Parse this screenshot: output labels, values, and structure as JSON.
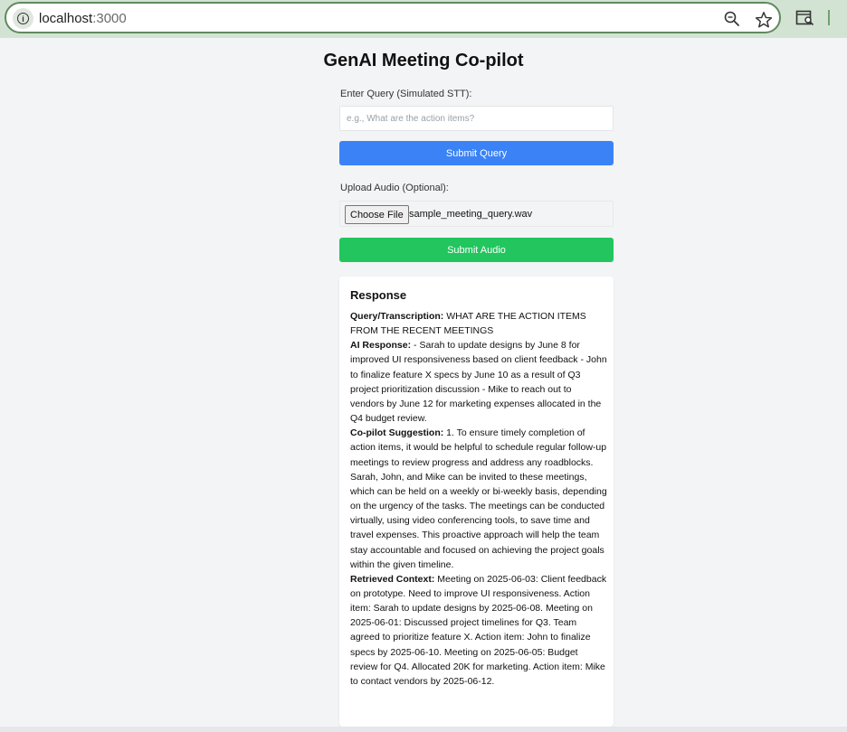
{
  "browser": {
    "url_host": "localhost",
    "url_port": ":3000",
    "icons": [
      "info-icon",
      "zoom-icon",
      "star-icon",
      "extension-icon"
    ]
  },
  "page": {
    "title": "GenAI Meeting Co-pilot",
    "query_label": "Enter Query (Simulated STT):",
    "query_placeholder": "e.g., What are the action items?",
    "query_value": "",
    "submit_query_label": "Submit Query",
    "upload_label": "Upload Audio (Optional):",
    "choose_file_label": "Choose File",
    "file_name": "sample_meeting_query.wav",
    "submit_audio_label": "Submit Audio"
  },
  "response": {
    "title": "Response",
    "query_heading": "Query/Transcription:",
    "query_text": "WHAT ARE THE ACTION ITEMS FROM THE RECENT MEETINGS",
    "ai_heading": "AI Response:",
    "ai_text": "- Sarah to update designs by June 8 for improved UI responsiveness based on client feedback - John to finalize feature X specs by June 10 as a result of Q3 project prioritization discussion - Mike to reach out to vendors by June 12 for marketing expenses allocated in the Q4 budget review.",
    "suggestion_heading": "Co-pilot Suggestion:",
    "suggestion_text": "1. To ensure timely completion of action items, it would be helpful to schedule regular follow-up meetings to review progress and address any roadblocks. Sarah, John, and Mike can be invited to these meetings, which can be held on a weekly or bi-weekly basis, depending on the urgency of the tasks. The meetings can be conducted virtually, using video conferencing tools, to save time and travel expenses. This proactive approach will help the team stay accountable and focused on achieving the project goals within the given timeline.",
    "context_heading": "Retrieved Context:",
    "context_text": "Meeting on 2025-06-03: Client feedback on prototype. Need to improve UI responsiveness. Action item: Sarah to update designs by 2025-06-08. Meeting on 2025-06-01: Discussed project timelines for Q3. Team agreed to prioritize feature X. Action item: John to finalize specs by 2025-06-10. Meeting on 2025-06-05: Budget review for Q4. Allocated 20K for marketing. Action item: Mike to contact vendors by 2025-06-12."
  },
  "colors": {
    "primary_button": "#3b82f6",
    "audio_button": "#22c55e",
    "page_background": "#f3f4f6"
  }
}
